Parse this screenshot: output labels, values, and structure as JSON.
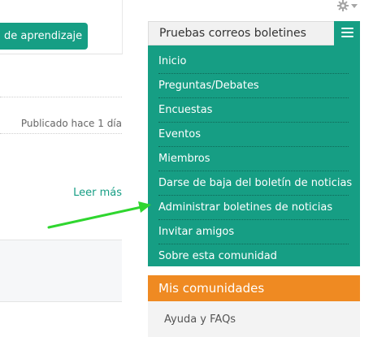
{
  "left": {
    "button_label": "de aprendizaje",
    "published": "Publicado hace 1 día",
    "read_more": "Leer más"
  },
  "widget": {
    "title": "Pruebas correos boletines",
    "items": [
      "Inicio",
      "Preguntas/Debates",
      "Encuestas",
      "Eventos",
      "Miembros",
      "Darse de baja del boletín de noticias",
      "Administrar boletines de noticias",
      "Invitar amigos",
      "Sobre esta comunidad"
    ]
  },
  "communities": {
    "title": "Mis comunidades",
    "items": [
      "Ayuda y FAQs"
    ]
  },
  "icons": {
    "gear": "gear-icon",
    "menu": "hamburger-menu-icon",
    "arrow": "green-arrow-annotation"
  },
  "colors": {
    "accent": "#169e84",
    "orange": "#ef8a22",
    "arrow": "#39e639"
  }
}
